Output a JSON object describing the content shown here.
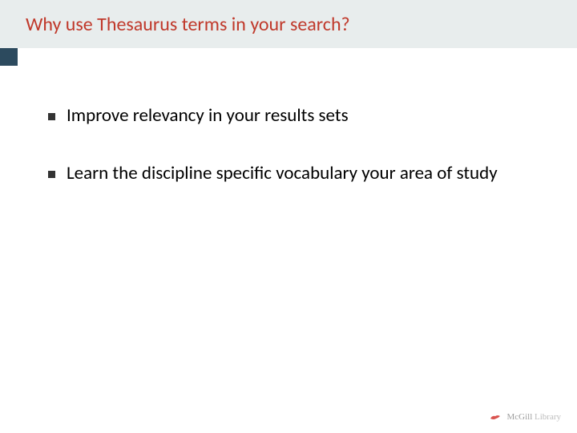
{
  "slide": {
    "title": "Why use Thesaurus terms in your search?",
    "bullets": [
      {
        "text": "Improve relevancy in your results sets"
      },
      {
        "text": "Learn the discipline specific vocabulary your area of study"
      }
    ]
  },
  "footer": {
    "logo_primary": "McGill",
    "logo_secondary": " Library"
  },
  "colors": {
    "title_bg": "#e8eded",
    "title_color": "#c0392b",
    "accent": "#2c4a5e",
    "bird": "#d9534f"
  }
}
